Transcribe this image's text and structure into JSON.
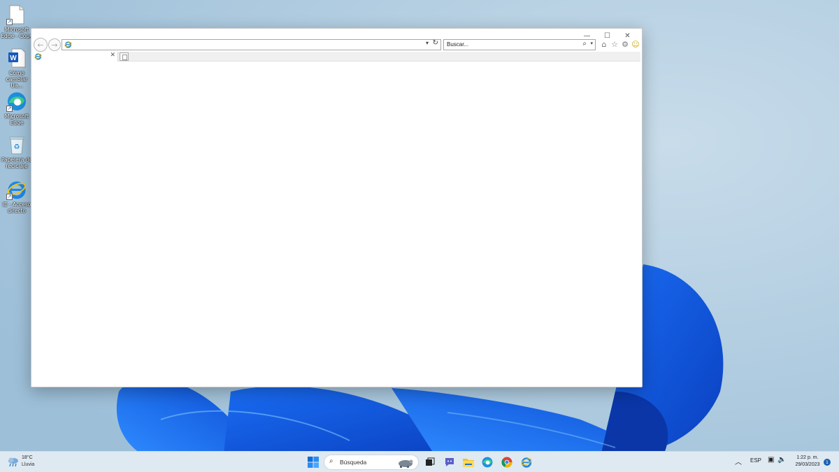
{
  "desktop": {
    "icons": [
      {
        "label": "Microsoft Edge - Copy",
        "icon": "blank-document-icon"
      },
      {
        "label": "Cómo cambiar Ua...",
        "icon": "word-document-icon"
      },
      {
        "label": "Microsoft Edge",
        "icon": "edge-icon"
      },
      {
        "label": "Papelera de reciclaje",
        "icon": "recycle-bin-icon"
      },
      {
        "label": "IE - Acceso directo",
        "icon": "internet-explorer-icon"
      }
    ]
  },
  "browser": {
    "title_buttons": {
      "minimize": "—",
      "maximize": "☐",
      "close": "✕"
    },
    "address_value": "",
    "search_placeholder": "Buscar...",
    "tab_title": "",
    "toolbar_icons": [
      "home-icon",
      "favorites-star-icon",
      "settings-gear-icon",
      "feedback-smiley-icon"
    ]
  },
  "taskbar": {
    "weather_temp": "18°C",
    "weather_cond": "Lluvia",
    "search_label": "Búsqueda",
    "apps": [
      "start-icon",
      "task-view-icon",
      "chat-icon",
      "file-explorer-icon",
      "edge-icon",
      "chrome-icon",
      "internet-explorer-icon"
    ],
    "language": "ESP",
    "time": "1:22 p. m.",
    "date": "29/03/2023",
    "notification_count": "1"
  }
}
